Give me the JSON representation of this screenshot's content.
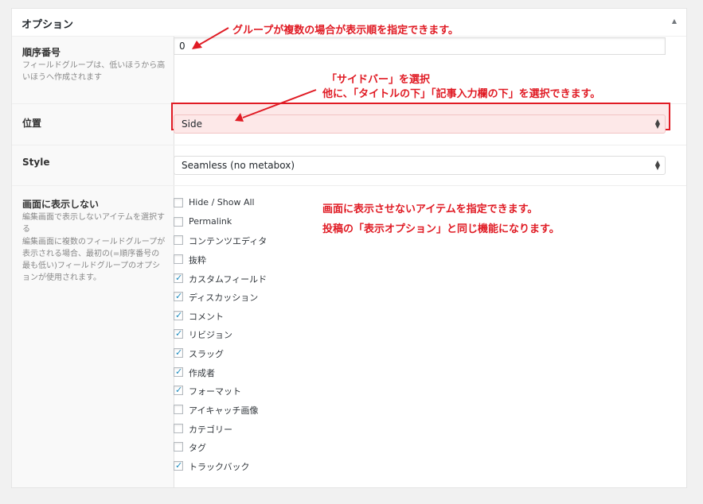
{
  "panel": {
    "title": "オプション",
    "toggle_icon": "triangle-up-icon"
  },
  "fields": {
    "order": {
      "label": "順序番号",
      "description": "フィールドグループは、低いほうから高いほうへ作成されます",
      "value": "0"
    },
    "position": {
      "label": "位置",
      "selected": "Side"
    },
    "style": {
      "label": "Style",
      "selected": "Seamless (no metabox)"
    },
    "hide": {
      "label": "画面に表示しない",
      "description_highlight": "編集画面で表示しないアイテムを選択する",
      "description": "編集画面に複数のフィールドグループが表示される場合、最初の(=順序番号の最も低い)フィールドグループのオプションが使用されます。",
      "items": [
        {
          "label": "Hide / Show All",
          "checked": false
        },
        {
          "label": "Permalink",
          "checked": false
        },
        {
          "label": "コンテンツエディタ",
          "checked": false
        },
        {
          "label": "抜粋",
          "checked": false
        },
        {
          "label": "カスタムフィールド",
          "checked": true
        },
        {
          "label": "ディスカッション",
          "checked": true
        },
        {
          "label": "コメント",
          "checked": true
        },
        {
          "label": "リビジョン",
          "checked": true
        },
        {
          "label": "スラッグ",
          "checked": true
        },
        {
          "label": "作成者",
          "checked": true
        },
        {
          "label": "フォーマット",
          "checked": true
        },
        {
          "label": "アイキャッチ画像",
          "checked": false
        },
        {
          "label": "カテゴリー",
          "checked": false
        },
        {
          "label": "タグ",
          "checked": false
        },
        {
          "label": "トラックバック",
          "checked": true
        }
      ]
    }
  },
  "annotations": {
    "order_note": "グループが複数の場合が表示順を指定できます。",
    "position_note_1": "「サイドバー」を選択",
    "position_note_2": "他に、「タイトルの下」「記事入力欄の下」を選択できます。",
    "hide_note_1": "画面に表示させないアイテムを指定できます。",
    "hide_note_2": "投稿の「表示オプション」と同じ機能になります。"
  },
  "colors": {
    "annotation": "#e01b24",
    "checkbox_check": "#1e8cbe",
    "highlight_fill": "#fde8e8"
  }
}
